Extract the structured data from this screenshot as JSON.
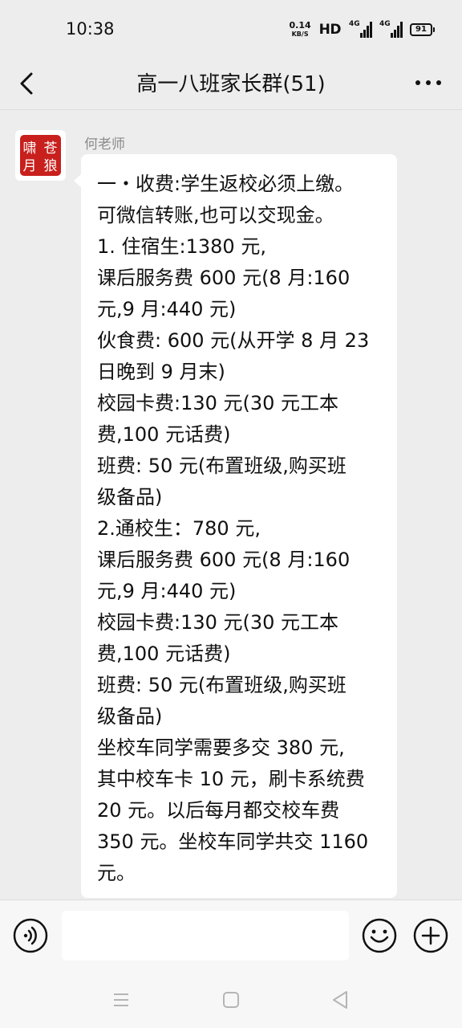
{
  "status_bar": {
    "time": "10:38",
    "net_speed_value": "0.14",
    "net_speed_unit": "KB/S",
    "hd_label": "HD",
    "signal1_label": "4G",
    "signal2_label": "4G",
    "battery": "91"
  },
  "header": {
    "title": "高一八班家长群(51)",
    "back_icon": "chevron-left-icon",
    "more_icon": "more-dots-icon"
  },
  "message": {
    "sender": "何老师",
    "avatar_icon": "red-seal-avatar",
    "lines": [
      "一・收费:学生返校必须上缴。",
      "  可微信转账,也可以交现金。",
      "1. 住宿生:1380 元,",
      "课后服务费 600 元(8 月:160",
      "元,9 月:440 元)",
      "伙食费:  600 元(从开学 8 月 23",
      "日晚到 9 月末)",
      "校园卡费:130 元(30 元工本",
      "费,100 元话费)",
      "班费:   50 元(布置班级,购买班",
      "级备品)",
      "2.通校生：780 元,",
      "课后服务费 600 元(8 月:160",
      "元,9 月:440 元)",
      "校园卡费:130 元(30 元工本",
      "费,100 元话费)",
      "班费:   50 元(布置班级,购买班",
      "级备品)",
      "坐校车同学需要多交 380 元,",
      "其中校车卡 10 元，刷卡系统费",
      "20 元。以后每月都交校车费",
      "350 元。坐校车同学共交 1160",
      "元。"
    ]
  },
  "input_bar": {
    "voice_icon": "voice-icon",
    "emoji_icon": "emoji-icon",
    "plus_icon": "plus-icon",
    "input_value": "",
    "placeholder": ""
  },
  "nav_bar": {
    "menu_icon": "menu-icon",
    "home_icon": "home-icon",
    "back_icon": "back-triangle-icon"
  },
  "colors": {
    "background": "#ededed",
    "bubble": "#ffffff",
    "seal_red": "#c8201d"
  }
}
